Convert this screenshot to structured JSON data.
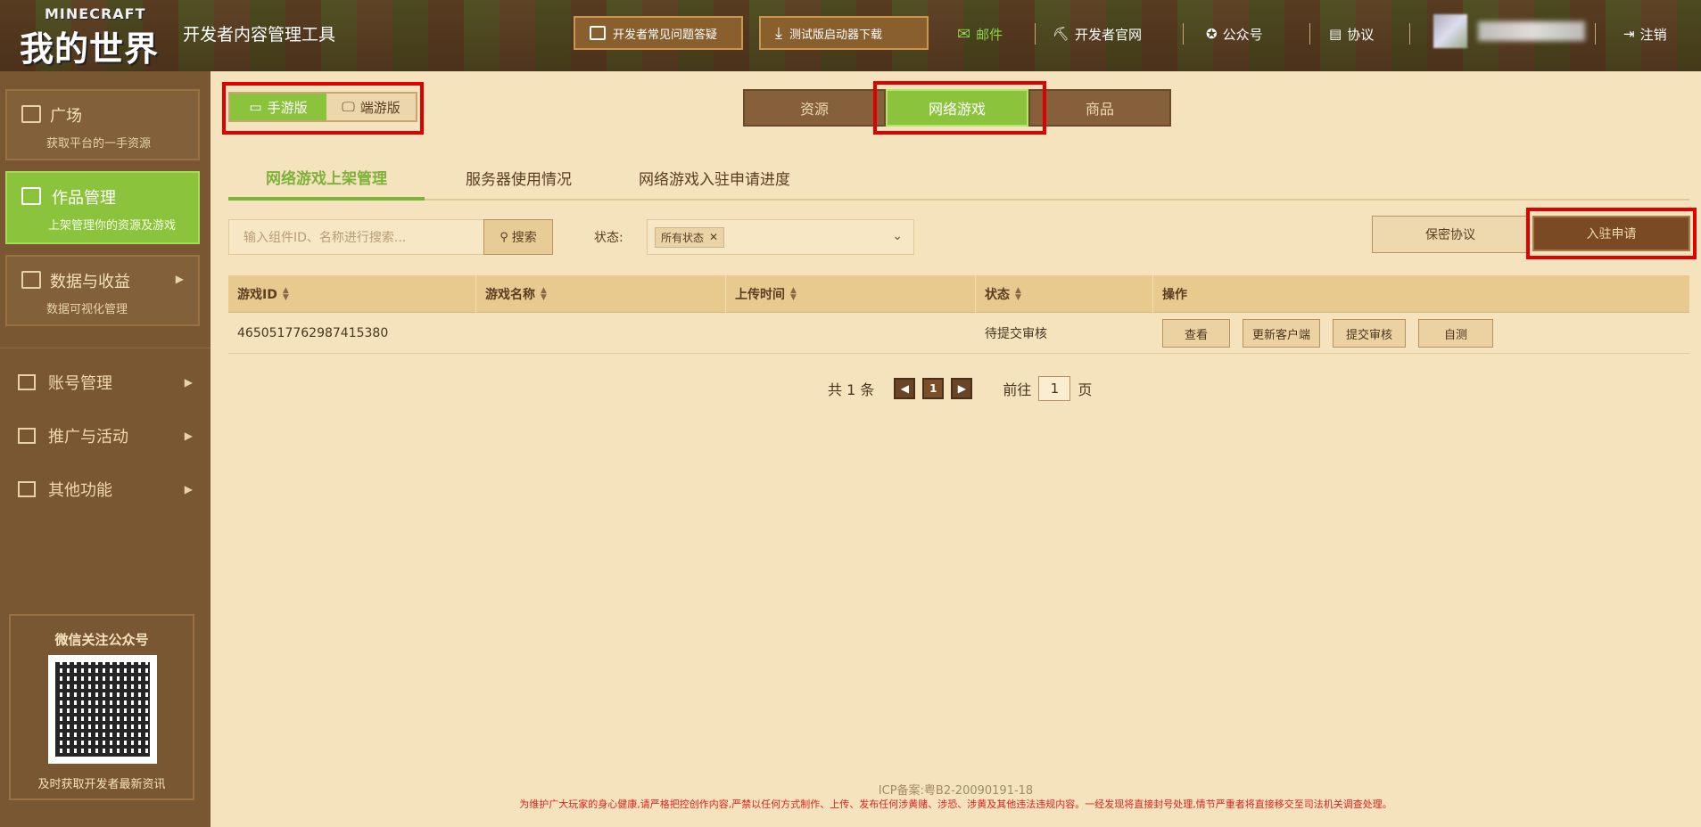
{
  "header": {
    "logo_top": "MINECRAFT",
    "logo_main": "我的世界",
    "app_title": "开发者内容管理工具",
    "faq_button": "开发者常见问题答疑",
    "download_button": "测试版启动器下载",
    "mail": "邮件",
    "dev_site": "开发者官网",
    "official_account": "公众号",
    "agreement": "协议",
    "logout": "注销"
  },
  "sidebar": {
    "plaza": {
      "title": "广场",
      "sub": "获取平台的一手资源"
    },
    "works": {
      "title": "作品管理",
      "sub": "上架管理你的资源及游戏"
    },
    "data": {
      "title": "数据与收益",
      "sub": "数据可视化管理"
    },
    "menu": [
      "账号管理",
      "推广与活动",
      "其他功能"
    ],
    "wechat_title": "微信关注公众号",
    "wechat_footer": "及时获取开发者最新资讯"
  },
  "platform": {
    "mobile": "手游版",
    "pc": "端游版",
    "selected": "手游版"
  },
  "top_tabs": {
    "items": [
      "资源",
      "网络游戏",
      "商品"
    ],
    "selected": "网络游戏"
  },
  "sub_tabs": {
    "items": [
      "网络游戏上架管理",
      "服务器使用情况",
      "网络游戏入驻申请进度"
    ],
    "selected": "网络游戏上架管理"
  },
  "filters": {
    "search_placeholder": "输入组件ID、名称进行搜索...",
    "search_button": "搜索",
    "status_label": "状态:",
    "status_chip": "所有状态"
  },
  "actions": {
    "nda": "保密协议",
    "apply": "入驻申请"
  },
  "table": {
    "headers": [
      "游戏ID",
      "游戏名称",
      "上传时间",
      "状态",
      "操作"
    ],
    "rows": [
      {
        "id": "4650517762987415380",
        "name": "",
        "upload_time": "",
        "status": "待提交审核",
        "ops": [
          "查看",
          "更新客户端",
          "提交审核",
          "自测"
        ]
      }
    ]
  },
  "pagination": {
    "total": "共 1 条",
    "current": "1",
    "goto_label": "前往",
    "goto_value": "1",
    "page_unit": "页"
  },
  "footer": {
    "icp": "ICP备案:粤B2-20090191-18",
    "notice": "为维护广大玩家的身心健康,请严格把控创作内容,严禁以任何方式制作、上传、发布任何涉黄赌、涉恐、涉黄及其他违法违规内容。一经发现将直接封号处理,情节严重者将直接移交至司法机关调查处理。"
  },
  "colors": {
    "accent_green": "#8bc43c",
    "brown": "#7a5733",
    "cream": "#f5e3bd",
    "highlight_red": "#e00000"
  }
}
